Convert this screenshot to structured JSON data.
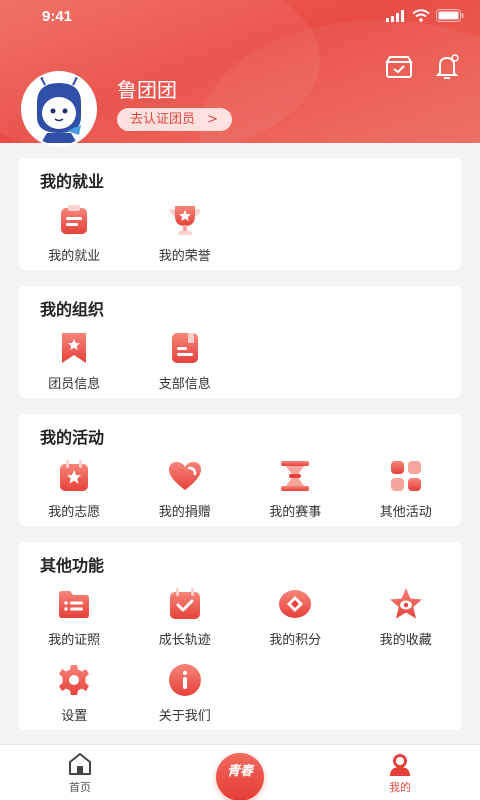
{
  "status_bar": {
    "time": "9:41"
  },
  "profile": {
    "name": "鲁团团",
    "verify_label": "去认证团员",
    "verify_arrow": ">"
  },
  "sections": [
    {
      "title": "我的就业",
      "items": [
        {
          "label": "我的就业",
          "icon": "clipboard-icon"
        },
        {
          "label": "我的荣誉",
          "icon": "trophy-icon"
        }
      ]
    },
    {
      "title": "我的组织",
      "items": [
        {
          "label": "团员信息",
          "icon": "bookmark-star-icon"
        },
        {
          "label": "支部信息",
          "icon": "notebook-icon"
        }
      ]
    },
    {
      "title": "我的活动",
      "items": [
        {
          "label": "我的志愿",
          "icon": "calendar-star-icon"
        },
        {
          "label": "我的捐赠",
          "icon": "heart-icon"
        },
        {
          "label": "我的赛事",
          "icon": "hourglass-icon"
        },
        {
          "label": "其他活动",
          "icon": "apps-icon"
        }
      ]
    },
    {
      "title": "其他功能",
      "items": [
        {
          "label": "我的证照",
          "icon": "folder-icon"
        },
        {
          "label": "成长轨迹",
          "icon": "calendar-check-icon"
        },
        {
          "label": "我的积分",
          "icon": "points-icon"
        },
        {
          "label": "我的收藏",
          "icon": "star-icon"
        },
        {
          "label": "设置",
          "icon": "gear-icon"
        },
        {
          "label": "关于我们",
          "icon": "info-icon"
        }
      ]
    }
  ],
  "tabbar": {
    "home_label": "首页",
    "center_label": "青春",
    "mine_label": "我的"
  },
  "colors": {
    "accent": "#e84c45",
    "accent_light": "#f26a5e",
    "background": "#f3f3f6"
  }
}
